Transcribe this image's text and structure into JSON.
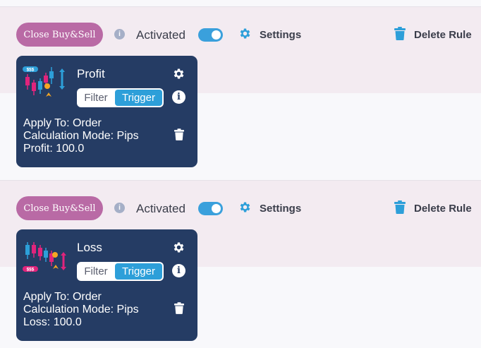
{
  "colors": {
    "band": "#f3ebf1",
    "page": "#f8f8fb",
    "action_button": "#b96aa5",
    "toggle_on": "#3aa0dc",
    "accent_blue": "#2d9fd9",
    "card_bg": "#253c64",
    "info_icon": "#a5afc7"
  },
  "rules": [
    {
      "action_label": "Close Buy&Sell",
      "status_label": "Activated",
      "toggle_on": true,
      "settings_label": "Settings",
      "delete_label": "Delete Rule",
      "condition": {
        "icon": "profit-chart-icon",
        "title": "Profit",
        "filter_label": "Filter",
        "trigger_label": "Trigger",
        "selected": "Trigger",
        "details": [
          "Apply To: Order",
          "Calculation Mode: Pips",
          "Profit: 100.0"
        ]
      }
    },
    {
      "action_label": "Close Buy&Sell",
      "status_label": "Activated",
      "toggle_on": true,
      "settings_label": "Settings",
      "delete_label": "Delete Rule",
      "condition": {
        "icon": "loss-chart-icon",
        "title": "Loss",
        "filter_label": "Filter",
        "trigger_label": "Trigger",
        "selected": "Trigger",
        "details": [
          "Apply To: Order",
          "Calculation Mode: Pips",
          "Loss: 100.0"
        ]
      }
    }
  ]
}
